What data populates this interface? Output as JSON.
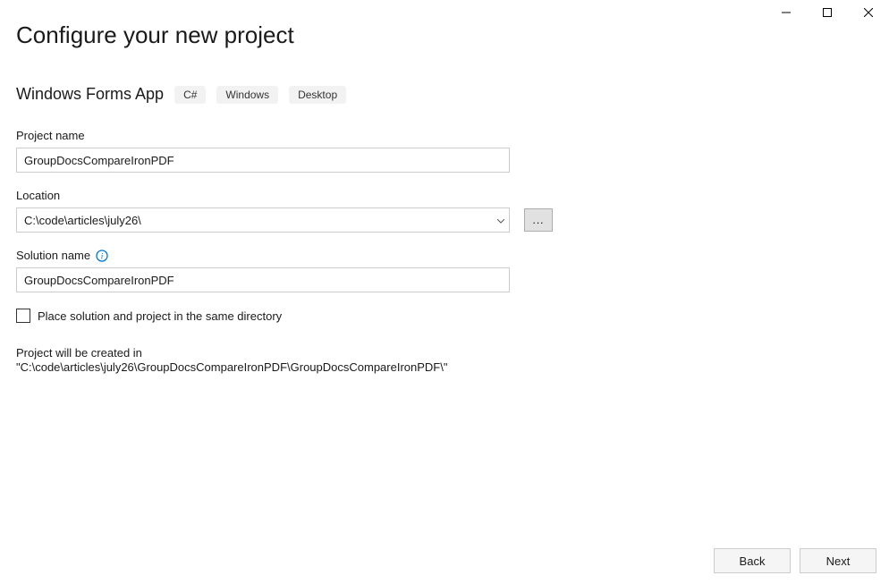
{
  "window": {
    "page_title": "Configure your new project",
    "template_name": "Windows Forms App",
    "tags": [
      "C#",
      "Windows",
      "Desktop"
    ]
  },
  "fields": {
    "project_name_label": "Project name",
    "project_name_value": "GroupDocsCompareIronPDF",
    "location_label": "Location",
    "location_value": "C:\\code\\articles\\july26\\",
    "browse_label": "...",
    "solution_name_label": "Solution name",
    "solution_name_value": "GroupDocsCompareIronPDF",
    "same_dir_label": "Place solution and project in the same directory"
  },
  "summary": "Project will be created in \"C:\\code\\articles\\july26\\GroupDocsCompareIronPDF\\GroupDocsCompareIronPDF\\\"",
  "footer": {
    "back_label": "Back",
    "next_label": "Next"
  }
}
